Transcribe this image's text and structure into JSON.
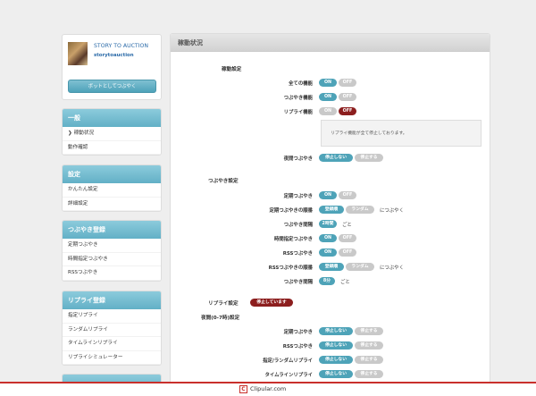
{
  "profile": {
    "name": "STORY TO AUCTION",
    "id": "storytoauction",
    "bot_button": "ボットとしてつぶやく"
  },
  "sidebar": {
    "general": {
      "title": "一般",
      "items": [
        "稼動状況",
        "動作確認"
      ]
    },
    "settings": {
      "title": "設定",
      "items": [
        "かんたん設定",
        "詳細設定"
      ]
    },
    "tweets": {
      "title": "つぶやき登録",
      "items": [
        "定期つぶやき",
        "時間指定つぶやき",
        "RSSつぶやき"
      ]
    },
    "replies": {
      "title": "リプライ登録",
      "items": [
        "指定リプライ",
        "ランダムリプライ",
        "タイムラインリプライ",
        "リプライシミュレーター"
      ]
    }
  },
  "main": {
    "title": "稼動状況",
    "status": {
      "title": "稼動設定",
      "all_label": "全ての機能",
      "tweet_label": "つぶやき機能",
      "reply_label": "リプライ機能",
      "notice": "リプライ機能が全て停止しております。",
      "night_label": "夜間つぶやき"
    },
    "tweet_settings": {
      "title": "つぶやき設定",
      "regular_label": "定期つぶやき",
      "order_label": "定期つぶやきの順番",
      "order_registered": "登録順",
      "order_random": "ランダム",
      "order_suffix": "につぶやく",
      "interval_label": "つぶやき間隔",
      "interval_value": "2時間",
      "interval_suffix": "ごと",
      "timed_label": "時間指定つぶやき",
      "rss_label": "RSSつぶやき",
      "rss_order_label": "RSSつぶやきの順番",
      "rss_order_registered": "登録順",
      "rss_order_random": "ランダム",
      "rss_order_suffix": "につぶやく",
      "rss_interval_label": "つぶやき間隔",
      "rss_interval_value": "8分",
      "rss_interval_suffix": "ごと"
    },
    "reply_settings": {
      "title": "リプライ設定",
      "badge": "停止しています",
      "night_title": "夜間(0-7時)設定",
      "rows": [
        "定期つぶやき",
        "RSSつぶやき",
        "指定/ランダムリプライ",
        "タイムラインリプライ"
      ]
    },
    "on": "ON",
    "off": "OFF",
    "no_stop": "停止しない",
    "stop": "停止する"
  },
  "footer": {
    "brand": "Clipular.com"
  },
  "colors": {
    "accent": "#4ea3b8",
    "off": "#c9c9c9",
    "danger": "#8c1e1e"
  }
}
